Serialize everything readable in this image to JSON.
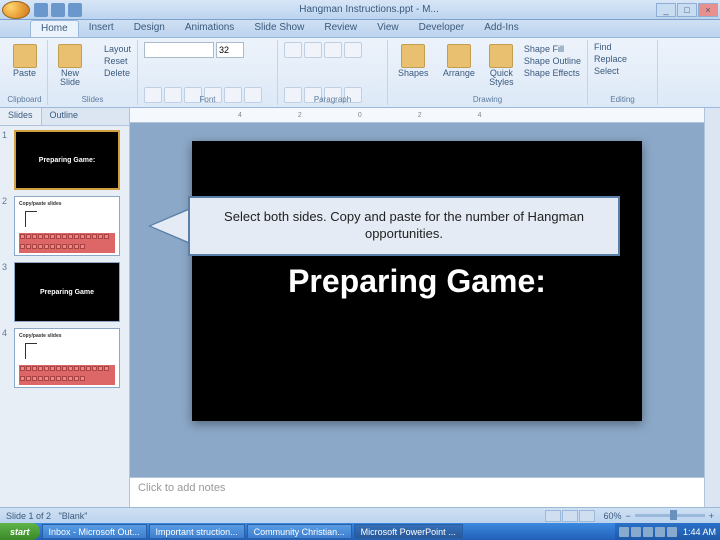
{
  "title": "Hangman Instructions.ppt - M...",
  "ribbon_tabs": [
    "Home",
    "Insert",
    "Design",
    "Animations",
    "Slide Show",
    "Review",
    "View",
    "Developer",
    "Add-Ins"
  ],
  "active_tab": "Home",
  "groups": {
    "clipboard": {
      "label": "Clipboard",
      "paste": "Paste"
    },
    "slides": {
      "label": "Slides",
      "new": "New\nSlide",
      "layout": "Layout",
      "reset": "Reset",
      "delete": "Delete"
    },
    "font": {
      "label": "Font",
      "size": "32"
    },
    "paragraph": {
      "label": "Paragraph"
    },
    "drawing": {
      "label": "Drawing",
      "shapes": "Shapes",
      "arrange": "Arrange",
      "quick": "Quick\nStyles",
      "fill": "Shape Fill",
      "outline": "Shape Outline",
      "effects": "Shape Effects"
    },
    "editing": {
      "label": "Editing",
      "find": "Find",
      "replace": "Replace",
      "select": "Select"
    }
  },
  "pane_tabs": [
    "Slides",
    "Outline"
  ],
  "active_pane": "Slides",
  "thumbs": [
    {
      "n": "1",
      "title": "Preparing Game:",
      "black": true,
      "sel": true
    },
    {
      "n": "2",
      "title": "",
      "black": false,
      "hangman": true
    },
    {
      "n": "3",
      "title": "Preparing Game",
      "black": true
    },
    {
      "n": "4",
      "title": "",
      "black": false,
      "hangman": true
    }
  ],
  "ruler_marks": [
    "4",
    "2",
    "0",
    "2",
    "4"
  ],
  "slide": {
    "title": "Preparing Game:"
  },
  "callout": "Select both sides.  Copy and paste for the number of Hangman opportunities.",
  "notes_placeholder": "Click to add notes",
  "status": {
    "slide": "Slide 1 of 2",
    "theme": "\"Blank\"",
    "zoom": "60%"
  },
  "taskbar": {
    "start": "start",
    "items": [
      "Inbox - Microsoft Out...",
      "Important  struction...",
      "Community Christian...",
      "Microsoft PowerPoint ..."
    ],
    "time": "1:44 AM"
  }
}
